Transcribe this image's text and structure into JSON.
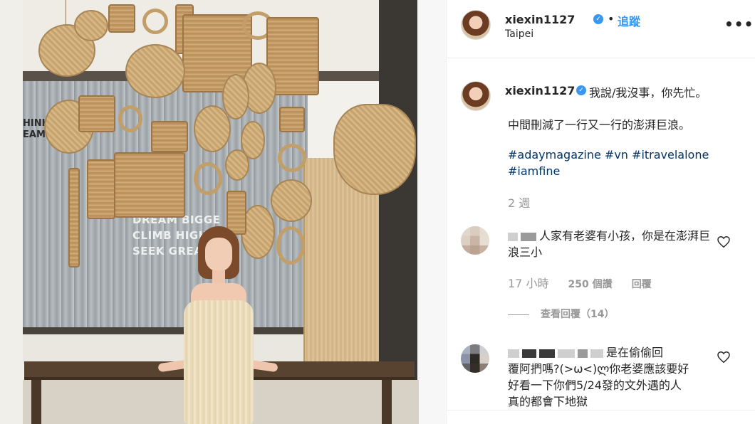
{
  "post": {
    "username": "xiexin1127",
    "follow_label": "追蹤",
    "separator": "•",
    "location": "Taipei",
    "more_label": "•••",
    "verified_glyph": "✓"
  },
  "caption": {
    "username": "xiexin1127",
    "line1": "我說/我沒事，你先忙。",
    "line2": "中間刪減了一行又一行的澎湃巨浪。",
    "hashtags": [
      "#adaymagazine",
      "#vn",
      "#itravelalone",
      "#iamfine"
    ],
    "time_ago": "2 週"
  },
  "comments": [
    {
      "text_visible": "人家有老婆有小孩，你是在澎湃巨浪三小",
      "time": "17 小時",
      "likes": "250 個讚",
      "reply_label": "回覆",
      "view_replies": "查看回覆（14）"
    },
    {
      "text_visible_1": "是在偷偷回",
      "text_visible_2": "覆阿捫嗎?(>ω<)ლ你老婆應該要好",
      "text_visible_3": "好看一下你們5/24發的文外遇的人",
      "text_visible_4": "真的都會下地獄"
    }
  ],
  "photo": {
    "sign_lines": [
      "DREAM BIGGE",
      "CLIMB HIGHE",
      "SEEK GREAT"
    ],
    "sign_small": [
      "HINK",
      "EAM"
    ]
  },
  "icons": {
    "heart": "heart-icon",
    "verified": "verified-badge-icon",
    "more": "more-options-icon"
  },
  "colors": {
    "link": "#3897f0",
    "hashtag": "#003569",
    "muted": "#999999",
    "text": "#262626"
  }
}
